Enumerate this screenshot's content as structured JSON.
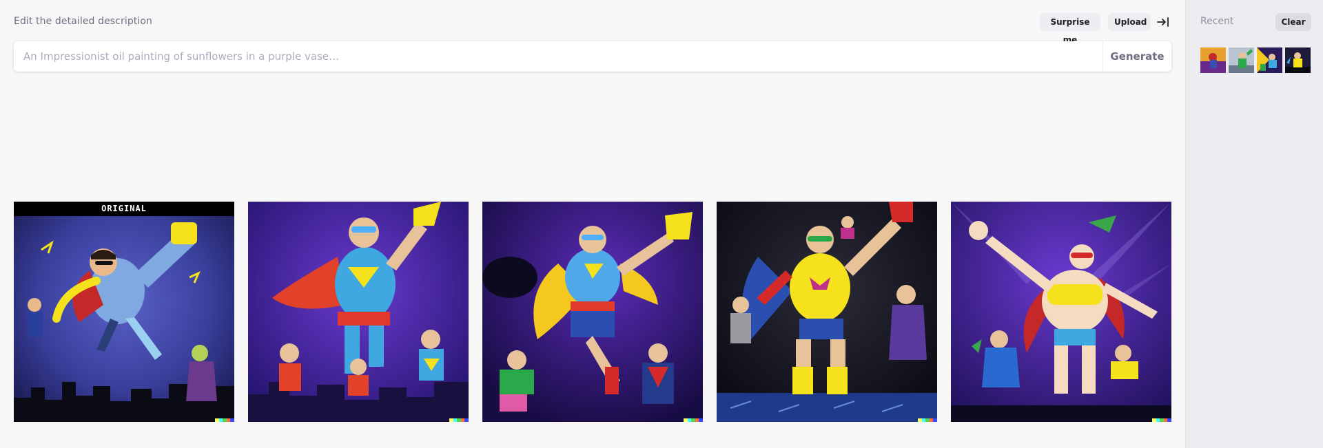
{
  "header": {
    "title": "Edit the detailed description",
    "surprise_label": "Surprise me",
    "upload_label": "Upload",
    "collapse_icon": "collapse-right-icon"
  },
  "prompt": {
    "value": "",
    "placeholder": "An Impressionist oil painting of sunflowers in a purple vase…",
    "generate_label": "Generate"
  },
  "gallery": {
    "original_label": "ORIGINAL",
    "images": [
      {
        "description": "superhero flying with yellow fist",
        "is_original": true
      },
      {
        "description": "superhero with red cape and yellow glove",
        "is_original": false
      },
      {
        "description": "superhero with yellow cape and yellow glove",
        "is_original": false
      },
      {
        "description": "superhero in yellow suit with red glove",
        "is_original": false
      },
      {
        "description": "superhero team with red cape",
        "is_original": false
      }
    ],
    "signature_colors": [
      "#ffff66",
      "#42ffff",
      "#51da4c",
      "#ff6e3c",
      "#3c46ff"
    ]
  },
  "sidebar": {
    "title": "Recent",
    "clear_label": "Clear",
    "recent_count": 4
  },
  "colors": {
    "background": "#f7f7f8",
    "sidebar_bg": "#ececf1",
    "pill_bg": "#ececf1",
    "muted_text": "#6e6e80",
    "placeholder_text": "#acacbe"
  }
}
